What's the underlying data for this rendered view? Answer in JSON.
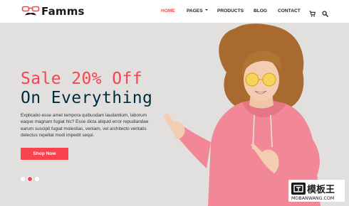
{
  "brand": {
    "name": "Famms",
    "accent": "#f7444e",
    "dark": "#002c3e"
  },
  "nav": {
    "items": [
      {
        "label": "HOME",
        "active": true
      },
      {
        "label": "PAGES",
        "dropdown": true
      },
      {
        "label": "PRODUCTS"
      },
      {
        "label": "BLOG"
      },
      {
        "label": "CONTACT"
      }
    ],
    "icons": [
      "cart-icon",
      "search-icon"
    ]
  },
  "hero": {
    "headline_line1": "Sale 20% Off",
    "headline_line2": "On Everything",
    "description_lines": [
      "Explicabo esse amet tempora quibusdam laudantium, laborum",
      "eaque magnam fugiat hic? Esse dicta aliquid error repudiandae",
      "earum suscipit fugiat molestias, veniam, vel architecto veritatis",
      "delectus repellat modi impedit sequi."
    ],
    "cta_label": "Shop Now",
    "slides": {
      "count": 3,
      "active": 2
    }
  },
  "watermark": {
    "text": "模板王",
    "domain": "MOBANWANG.COM"
  }
}
